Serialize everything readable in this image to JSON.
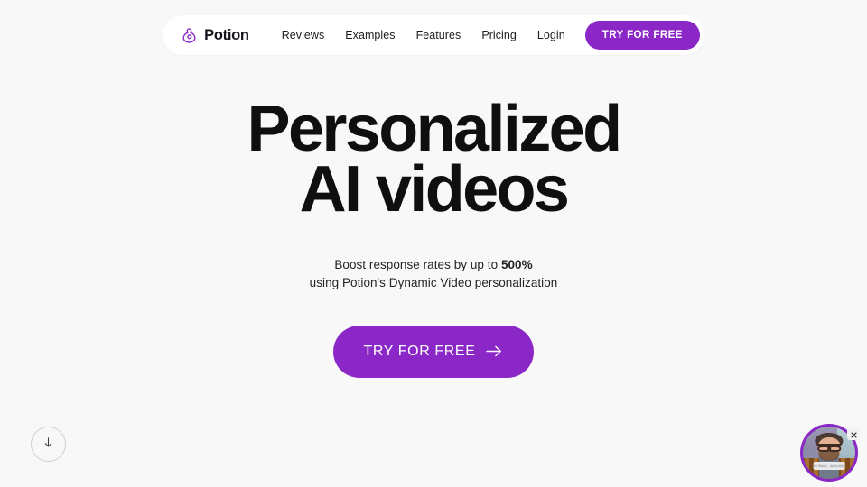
{
  "page": {
    "background_color": "#f8f8f8",
    "accent_color": "#8b27c7",
    "text_color": "#111111"
  },
  "navbar": {
    "brand": {
      "name": "Potion",
      "logo_icon": "potion-bottle-spiral-icon",
      "logo_color": "#8b27c7"
    },
    "links": [
      {
        "label": "Reviews"
      },
      {
        "label": "Examples"
      },
      {
        "label": "Features"
      },
      {
        "label": "Pricing"
      },
      {
        "label": "Login"
      }
    ],
    "cta_label": "TRY FOR FREE"
  },
  "hero": {
    "title_line1": "Personalized",
    "title_line2": "AI videos",
    "subtitle_line1_prefix": "Boost response rates by up to ",
    "subtitle_line1_highlight": "500%",
    "subtitle_line2": "using Potion's Dynamic Video personalization",
    "cta_label": "TRY FOR FREE",
    "cta_icon": "arrow-right-icon"
  },
  "scroll_down": {
    "icon": "arrow-down-icon",
    "label": "Scroll down"
  },
  "video_widget": {
    "avatar_alt": "Man with glasses and beard in plaid shirt",
    "caption_text": "Hi there, welcome",
    "ring_color": "#8b27c7",
    "close_icon": "close-x-icon"
  }
}
